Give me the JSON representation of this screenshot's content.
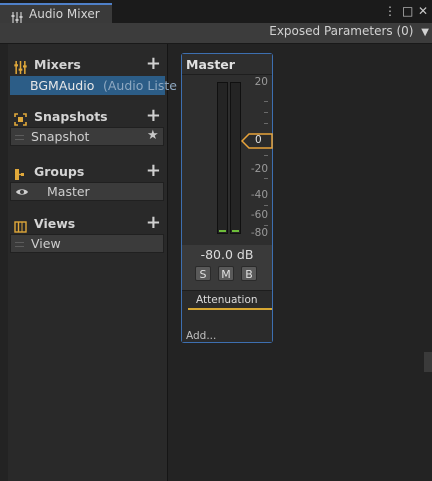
{
  "window": {
    "tab_title": "Audio Mixer",
    "tab_icon": "mixer-sliders-icon",
    "controls": [
      "⋮",
      "□",
      "✕"
    ]
  },
  "toolbar": {
    "exposed_params": "Exposed Parameters (0)"
  },
  "sidebar": {
    "mixers": {
      "title": "Mixers",
      "icon": "mixer-sliders-icon",
      "items": [
        {
          "name": "BGMAudio",
          "detail": "(Audio Liste"
        }
      ]
    },
    "snapshots": {
      "title": "Snapshots",
      "icon": "snapshot-icon",
      "items": [
        {
          "name": "Snapshot"
        }
      ]
    },
    "groups": {
      "title": "Groups",
      "icon": "groups-icon",
      "items": [
        {
          "name": "Master"
        }
      ]
    },
    "views": {
      "title": "Views",
      "icon": "views-icon",
      "items": [
        {
          "name": "View"
        }
      ]
    },
    "add_symbol": "+"
  },
  "strip": {
    "title": "Master",
    "ticks": [
      "20",
      "0",
      "-20",
      "-40",
      "-60",
      "-80"
    ],
    "fader_value": "0",
    "db_readout": "-80.0 dB",
    "buttons": [
      "S",
      "M",
      "B"
    ],
    "effect": "Attenuation",
    "add_label": "Add...",
    "colors": {
      "accent": "#3d6fb0",
      "level": "#6dbd3a",
      "attenuation": "#d6a733",
      "fader": "#e8a33a"
    }
  }
}
